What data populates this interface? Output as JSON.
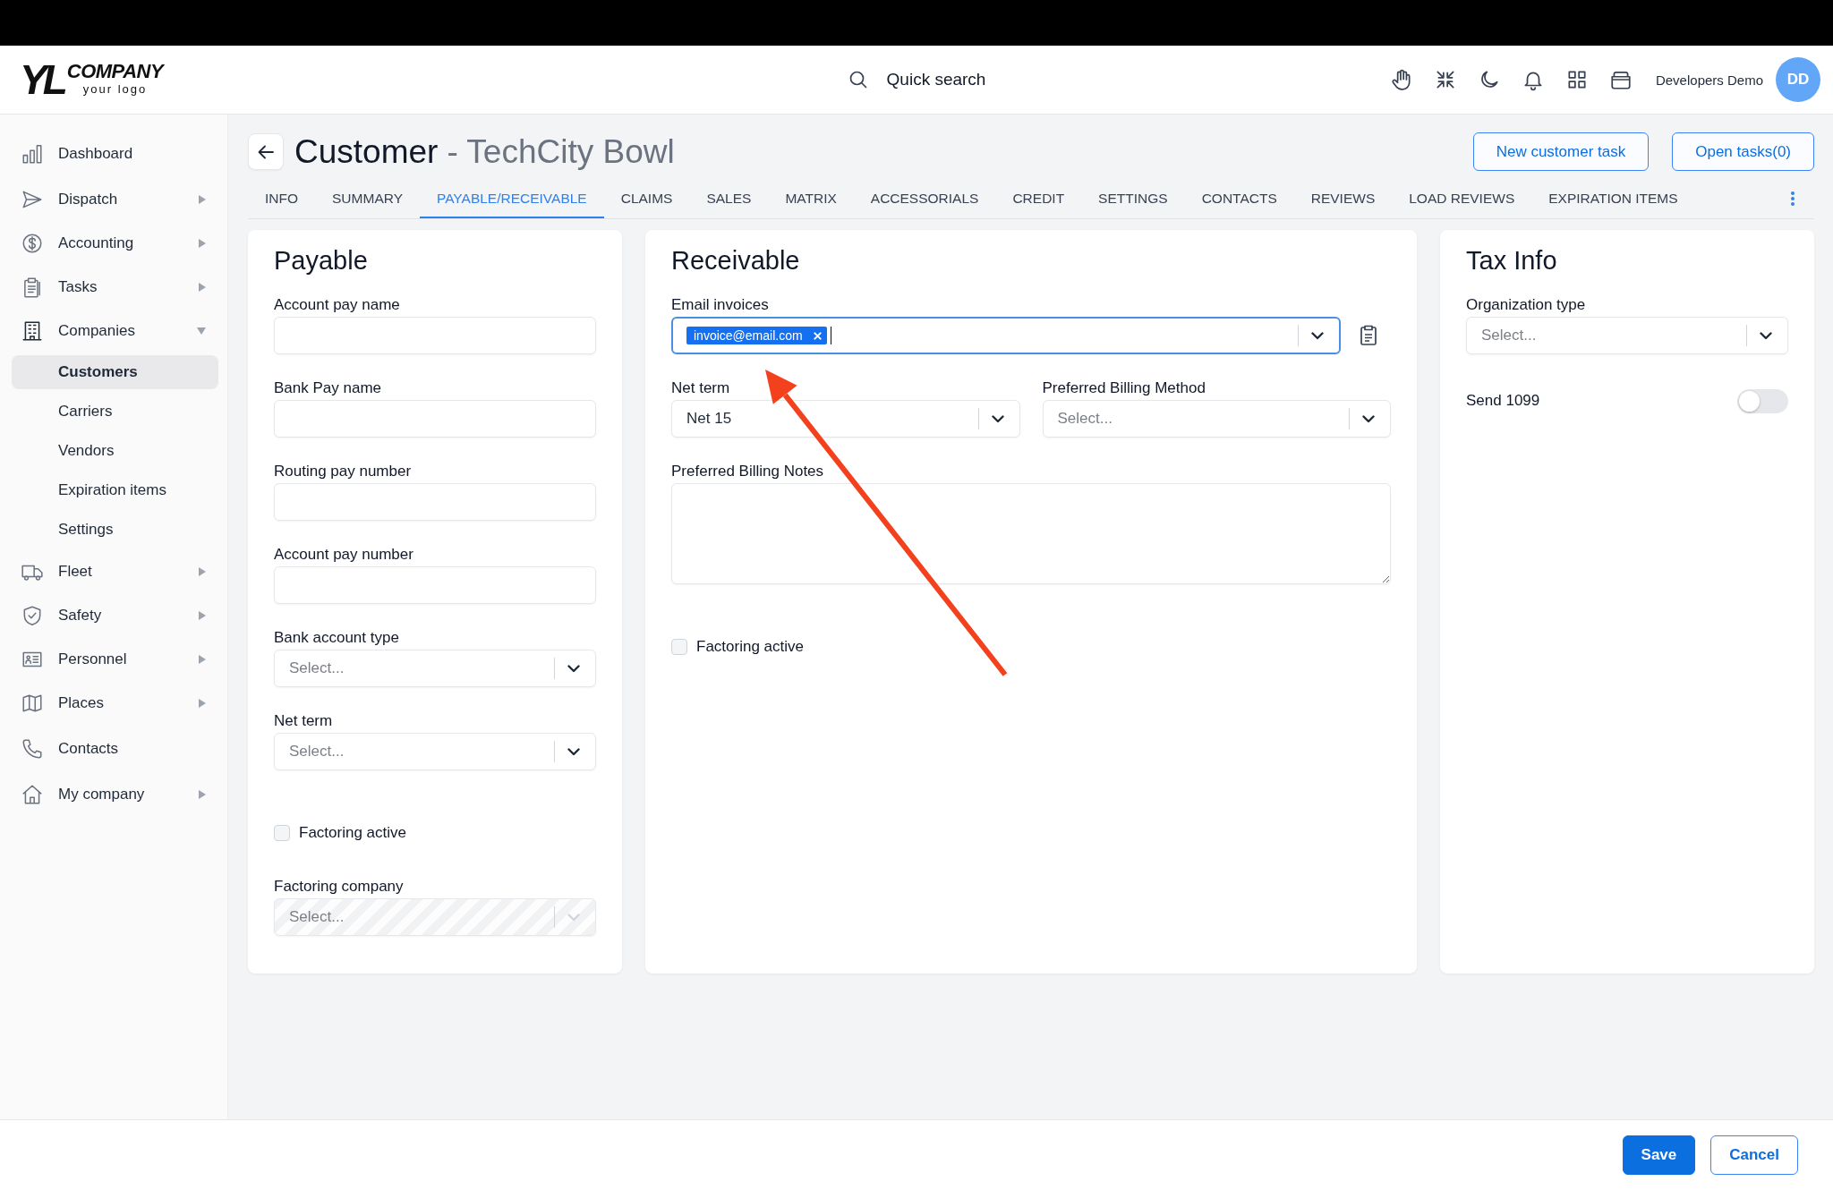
{
  "header": {
    "logo": {
      "mark": "YL",
      "name": "COMPANY",
      "tagline": "your logo"
    },
    "quick_search": {
      "label": "Quick search"
    },
    "user": {
      "name": "Developers Demo",
      "initials": "DD"
    }
  },
  "sidebar": {
    "items": [
      {
        "label": "Dashboard",
        "kind": "link",
        "selected": false
      },
      {
        "label": "Dispatch",
        "kind": "group",
        "expanded": false,
        "selected": false
      },
      {
        "label": "Accounting",
        "kind": "group",
        "expanded": false,
        "selected": false
      },
      {
        "label": "Tasks",
        "kind": "group",
        "expanded": false,
        "selected": false
      },
      {
        "label": "Companies",
        "kind": "group",
        "expanded": true,
        "selected": false,
        "children": [
          {
            "label": "Customers",
            "selected": true
          },
          {
            "label": "Carriers",
            "selected": false
          },
          {
            "label": "Vendors",
            "selected": false
          },
          {
            "label": "Expiration items",
            "selected": false
          },
          {
            "label": "Settings",
            "selected": false
          }
        ]
      },
      {
        "label": "Fleet",
        "kind": "group",
        "expanded": false,
        "selected": false
      },
      {
        "label": "Safety",
        "kind": "group",
        "expanded": false,
        "selected": false
      },
      {
        "label": "Personnel",
        "kind": "group",
        "expanded": false,
        "selected": false
      },
      {
        "label": "Places",
        "kind": "group",
        "expanded": false,
        "selected": false
      },
      {
        "label": "Contacts",
        "kind": "link",
        "selected": false
      },
      {
        "label": "My company",
        "kind": "group",
        "expanded": false,
        "selected": false
      }
    ]
  },
  "page": {
    "title": "Customer",
    "subtitle": "- TechCity Bowl",
    "actions": [
      {
        "label": "New customer task"
      },
      {
        "label": "Open tasks(0)"
      }
    ],
    "tabs": [
      {
        "label": "INFO",
        "selected": false
      },
      {
        "label": "SUMMARY",
        "selected": false
      },
      {
        "label": "PAYABLE/RECEIVABLE",
        "selected": true
      },
      {
        "label": "CLAIMS",
        "selected": false
      },
      {
        "label": "SALES",
        "selected": false
      },
      {
        "label": "MATRIX",
        "selected": false
      },
      {
        "label": "ACCESSORIALS",
        "selected": false
      },
      {
        "label": "CREDIT",
        "selected": false
      },
      {
        "label": "SETTINGS",
        "selected": false
      },
      {
        "label": "CONTACTS",
        "selected": false
      },
      {
        "label": "REVIEWS",
        "selected": false
      },
      {
        "label": "LOAD REVIEWS",
        "selected": false
      },
      {
        "label": "EXPIRATION ITEMS",
        "selected": false
      }
    ]
  },
  "panels": [
    {
      "title": "Payable",
      "rows": [
        [
          {
            "kind": "text",
            "label": "Account pay name"
          }
        ],
        [
          {
            "kind": "text",
            "label": "Bank Pay name"
          }
        ],
        [
          {
            "kind": "text",
            "label": "Routing pay number"
          }
        ],
        [
          {
            "kind": "text",
            "label": "Account pay number"
          }
        ],
        [
          {
            "kind": "select",
            "label": "Bank account type",
            "placeholder": "Select...",
            "disabled": false
          }
        ],
        [
          {
            "kind": "select",
            "label": "Net term",
            "placeholder": "Select...",
            "disabled": false
          }
        ],
        [
          {
            "kind": "checkbox",
            "label": "Factoring active",
            "checked": false
          }
        ],
        [
          {
            "kind": "select",
            "label": "Factoring company",
            "placeholder": "Select...",
            "disabled": true
          }
        ]
      ]
    },
    {
      "title": "Receivable",
      "annotation": {
        "kind": "arrow"
      },
      "rows": [
        [
          {
            "kind": "tags",
            "label": "Email invoices",
            "tags": [
              "invoice@email.com"
            ],
            "focused": true
          }
        ],
        [
          {
            "kind": "select",
            "label": "Net term",
            "value": "Net 15",
            "disabled": false
          },
          {
            "kind": "select",
            "label": "Preferred Billing Method",
            "placeholder": "Select...",
            "disabled": false
          }
        ],
        [
          {
            "kind": "textarea",
            "label": "Preferred Billing Notes"
          }
        ],
        [
          {
            "kind": "checkbox",
            "label": "Factoring active",
            "checked": false
          }
        ]
      ]
    },
    {
      "title": "Tax Info",
      "rows": [
        [
          {
            "kind": "select",
            "label": "Organization type",
            "placeholder": "Select...",
            "disabled": false
          }
        ],
        [
          {
            "kind": "toggle",
            "label": "Send 1099",
            "on": false
          }
        ]
      ]
    }
  ],
  "footer": {
    "buttons": [
      {
        "label": "Save",
        "kind": "primary"
      },
      {
        "label": "Cancel",
        "kind": "secondary"
      }
    ]
  }
}
